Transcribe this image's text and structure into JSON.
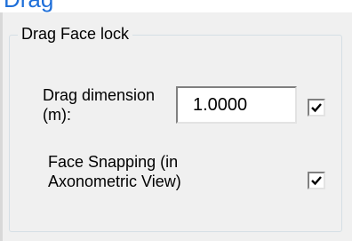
{
  "window_fragment": {
    "title_fragment": "Drag"
  },
  "group": {
    "title": "Drag Face lock"
  },
  "drag_dimension": {
    "label_line1": "Drag dimension",
    "label_line2": "(m):",
    "value": "1.0000",
    "checkbox": {
      "checked": true,
      "icon": "checkmark-icon"
    }
  },
  "face_snapping": {
    "label_line1": "Face Snapping (in",
    "label_line2": "Axonometric View)",
    "checkbox": {
      "checked": true,
      "icon": "checkmark-icon"
    }
  },
  "colors": {
    "accent_text": "#1e6fd9",
    "dialog_background": "#f0f0f0",
    "group_border": "#d5dfe5"
  }
}
